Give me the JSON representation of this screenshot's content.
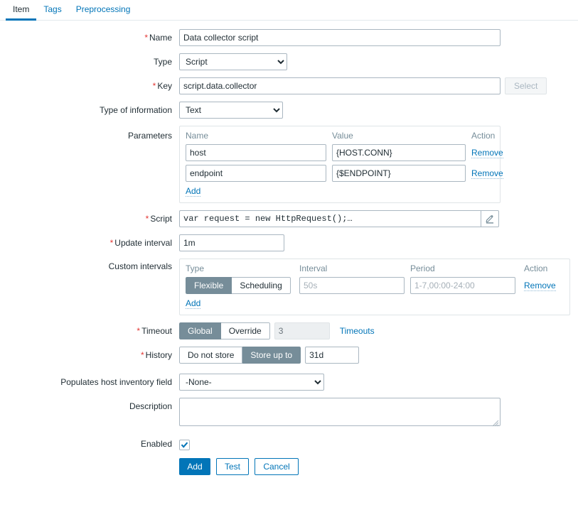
{
  "tabs": [
    {
      "label": "Item",
      "active": true
    },
    {
      "label": "Tags",
      "active": false
    },
    {
      "label": "Preprocessing",
      "active": false
    }
  ],
  "form": {
    "name": {
      "label": "Name",
      "required": true,
      "value": "Data collector script"
    },
    "type": {
      "label": "Type",
      "required": false,
      "value": "Script"
    },
    "key": {
      "label": "Key",
      "required": true,
      "value": "script.data.collector",
      "select_button": "Select"
    },
    "type_of_information": {
      "label": "Type of information",
      "required": false,
      "value": "Text"
    },
    "parameters": {
      "label": "Parameters",
      "columns": [
        "Name",
        "Value",
        "Action"
      ],
      "rows": [
        {
          "name": "host",
          "value": "{HOST.CONN}",
          "action": "Remove"
        },
        {
          "name": "endpoint",
          "value": "{$ENDPOINT}",
          "action": "Remove"
        }
      ],
      "add_label": "Add"
    },
    "script": {
      "label": "Script",
      "required": true,
      "value": "var request = new HttpRequest();…",
      "edit_icon": "pencil-icon"
    },
    "update_interval": {
      "label": "Update interval",
      "required": true,
      "value": "1m"
    },
    "custom_intervals": {
      "label": "Custom intervals",
      "columns": [
        "Type",
        "Interval",
        "Period",
        "Action"
      ],
      "rows": [
        {
          "type_options": [
            "Flexible",
            "Scheduling"
          ],
          "type_selected": "Flexible",
          "interval_value": "",
          "interval_placeholder": "50s",
          "period_value": "",
          "period_placeholder": "1-7,00:00-24:00",
          "action": "Remove"
        }
      ],
      "add_label": "Add"
    },
    "timeout": {
      "label": "Timeout",
      "required": true,
      "options": [
        "Global",
        "Override"
      ],
      "selected": "Global",
      "value": "3",
      "disabled": true,
      "link_label": "Timeouts"
    },
    "history": {
      "label": "History",
      "required": true,
      "options": [
        "Do not store",
        "Store up to"
      ],
      "selected": "Store up to",
      "value": "31d"
    },
    "inventory": {
      "label": "Populates host inventory field",
      "value": "-None-"
    },
    "description": {
      "label": "Description",
      "value": "",
      "placeholder": ""
    },
    "enabled": {
      "label": "Enabled",
      "checked": true
    }
  },
  "footer": {
    "add": "Add",
    "test": "Test",
    "cancel": "Cancel"
  },
  "colors": {
    "accent": "#0275b8",
    "toggle_on": "#768d99",
    "required": "#e33734",
    "label": "#1f2c33",
    "muted": "#768d99"
  }
}
